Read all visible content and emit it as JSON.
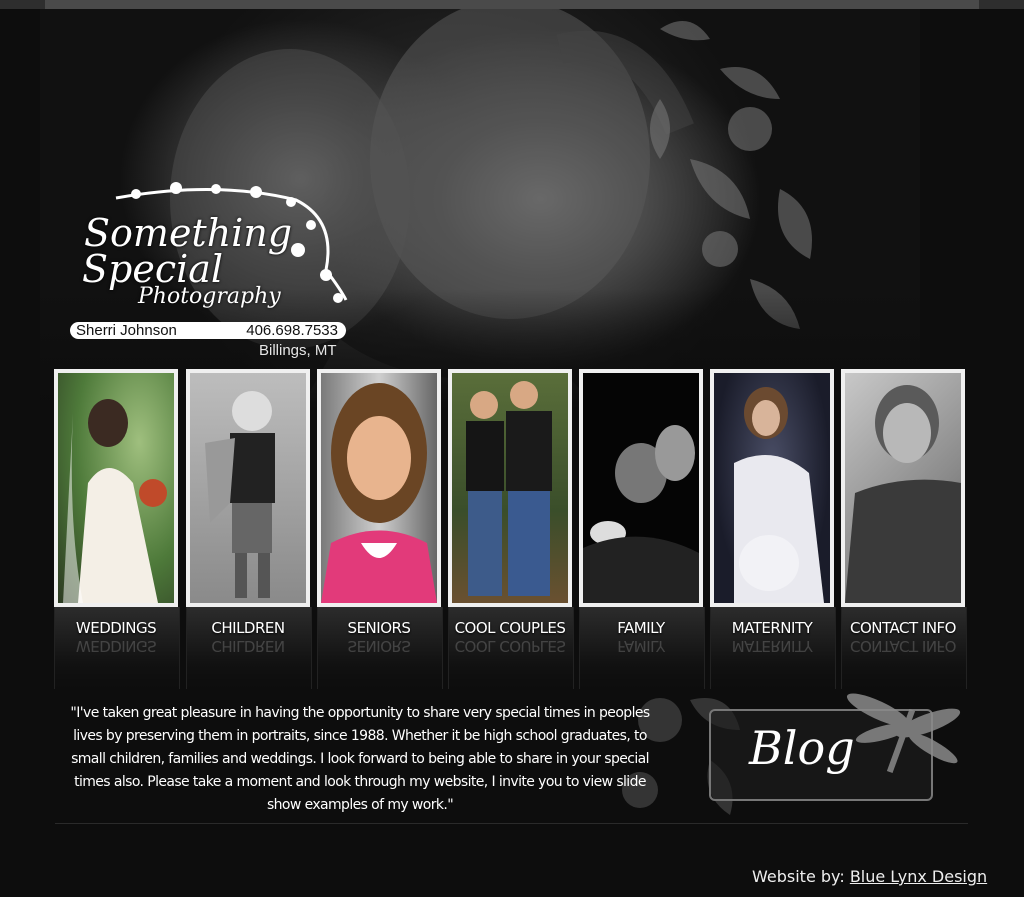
{
  "logo": {
    "line1": "Something",
    "line2": "Special",
    "line3": "Photography"
  },
  "contact": {
    "name": "Sherri Johnson",
    "phone": "406.698.7533",
    "city": "Billings, MT"
  },
  "gallery": [
    {
      "label": "WEDDINGS"
    },
    {
      "label": "CHILDREN"
    },
    {
      "label": "SENIORS"
    },
    {
      "label": "COOL COUPLES"
    },
    {
      "label": "FAMILY"
    },
    {
      "label": "MATERNITY"
    },
    {
      "label": "CONTACT INFO"
    }
  ],
  "quote": "\"I've taken great pleasure in having the opportunity to share very special times in peoples lives by preserving them in portraits, since 1988. Whether it be high school graduates, to small children, families and weddings. I look forward to being able to share in your special times also. Please take a moment and look through my website, I invite you to view slide show examples of my work.\"",
  "blog": {
    "label": "Blog"
  },
  "footer": {
    "prefix": "Website by:",
    "link_text": "Blue Lynx Design"
  }
}
